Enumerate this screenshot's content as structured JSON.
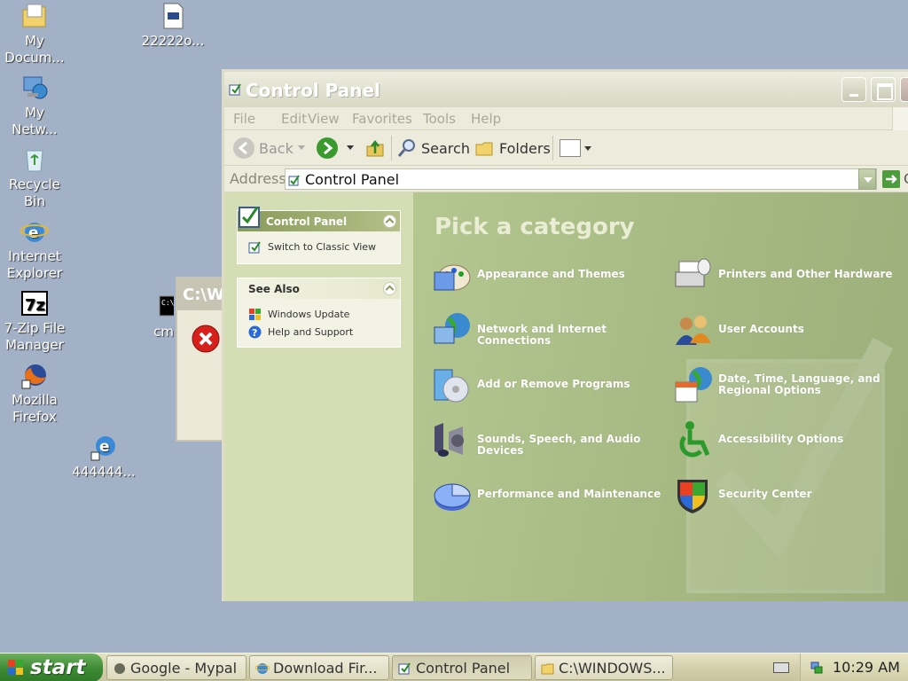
{
  "desktop": {
    "icons": [
      {
        "label": "My Docum...",
        "icon": "my-documents-icon"
      },
      {
        "label": "My Netw...",
        "icon": "my-network-icon"
      },
      {
        "label": "Recycle Bin",
        "icon": "recycle-bin-icon"
      },
      {
        "label": "Internet Explorer",
        "icon": "internet-explorer-icon"
      },
      {
        "label": "7-Zip File Manager",
        "icon": "7zip-icon"
      },
      {
        "label": "Mozilla Firefox",
        "icon": "firefox-icon"
      },
      {
        "label": "22222o...",
        "icon": "file-icon"
      },
      {
        "label": "cm",
        "icon": "cmd-icon"
      },
      {
        "label": "444444...",
        "icon": "ie-shortcut-icon"
      }
    ]
  },
  "background_dialog": {
    "title": "C:\\W"
  },
  "window": {
    "title": "Control Panel",
    "menu": [
      "File",
      "Edit",
      "View",
      "Favorites",
      "Tools",
      "Help"
    ],
    "toolbar": {
      "back": "Back",
      "search": "Search",
      "folders": "Folders"
    },
    "address": {
      "label": "Address",
      "value": "Control Panel",
      "go": "G"
    },
    "left_pane": {
      "control_panel_box": {
        "title": "Control Panel",
        "items": [
          "Switch to Classic View"
        ]
      },
      "see_also_box": {
        "title": "See Also",
        "items": [
          "Windows Update",
          "Help and Support"
        ]
      }
    },
    "main": {
      "heading": "Pick a category",
      "categories": [
        {
          "label": "Appearance and Themes",
          "icon": "appearance-themes-icon"
        },
        {
          "label": "Printers and Other Hardware",
          "icon": "printer-icon"
        },
        {
          "label": "Network and Internet Connections",
          "icon": "network-globe-icon"
        },
        {
          "label": "User Accounts",
          "icon": "user-accounts-icon"
        },
        {
          "label": "Add or Remove Programs",
          "icon": "add-remove-programs-icon"
        },
        {
          "label": "Date, Time, Language, and Regional Options",
          "icon": "date-time-globe-icon"
        },
        {
          "label": "Sounds, Speech, and Audio Devices",
          "icon": "speaker-icon"
        },
        {
          "label": "Accessibility Options",
          "icon": "accessibility-icon"
        },
        {
          "label": "Performance and Maintenance",
          "icon": "pie-chart-icon"
        },
        {
          "label": "Security Center",
          "icon": "shield-icon"
        }
      ]
    }
  },
  "taskbar": {
    "start_label": "start",
    "tasks": [
      {
        "label": "Google - Mypal"
      },
      {
        "label": "Download Fir..."
      },
      {
        "label": "Control Panel"
      },
      {
        "label": "C:\\WINDOWS..."
      }
    ],
    "clock": "10:29 AM"
  },
  "colors": {
    "accent": "#4d9c3e",
    "desktop": "#a3b1c7",
    "pane": "#a6b982"
  }
}
